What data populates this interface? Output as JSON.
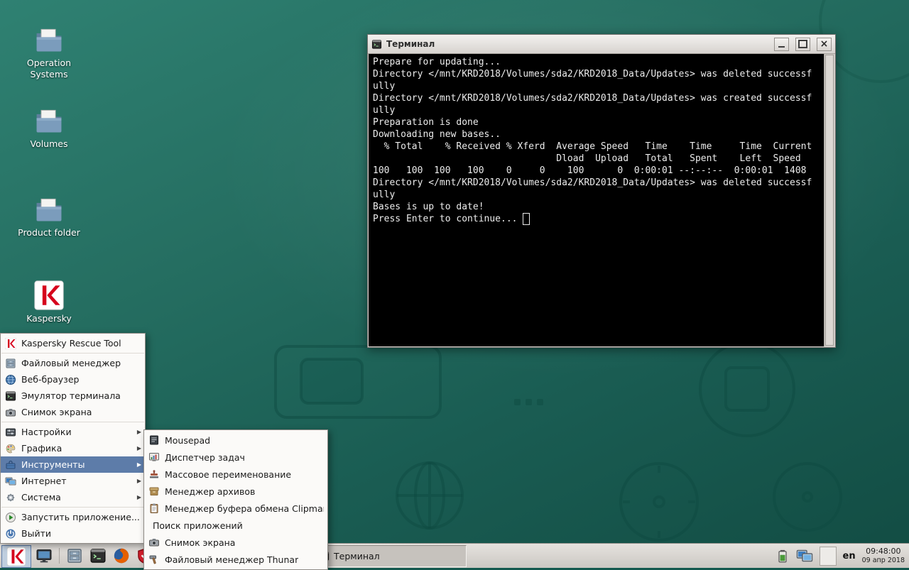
{
  "colors": {
    "desktop_teal": "#1f6a5e",
    "menu_highlight_blue": "#5d7ca9",
    "kaspersky_red": "#d6001c",
    "terminal_background": "#000000",
    "terminal_text": "#ffffff",
    "taskbar_gray": "#d5d1cc"
  },
  "desktop": {
    "icons": [
      {
        "label": "Operation Systems",
        "icon": "folder-icon"
      },
      {
        "label": "Volumes",
        "icon": "folder-icon"
      },
      {
        "label": "Product folder",
        "icon": "folder-icon"
      },
      {
        "label": "Kaspersky",
        "icon": "kaspersky-logo-icon"
      }
    ]
  },
  "terminal_window": {
    "title": "Терминал",
    "lines": [
      "Prepare for updating...",
      "Directory </mnt/KRD2018/Volumes/sda2/KRD2018_Data/Updates> was deleted successf",
      "ully",
      "Directory </mnt/KRD2018/Volumes/sda2/KRD2018_Data/Updates> was created successf",
      "ully",
      "Preparation is done",
      "Downloading new bases..",
      "  % Total    % Received % Xferd  Average Speed   Time    Time     Time  Current",
      "                                 Dload  Upload   Total   Spent    Left  Speed",
      "100   100  100   100    0     0    100      0  0:00:01 --:--:--  0:00:01  1408",
      "Directory </mnt/KRD2018/Volumes/sda2/KRD2018_Data/Updates> was deleted successf",
      "ully",
      "Bases is up to date!",
      "Press Enter to continue... "
    ]
  },
  "menu": {
    "items": [
      {
        "label": "Kaspersky Rescue Tool",
        "icon": "kaspersky-icon",
        "has_submenu": false
      },
      {
        "label": "Файловый менеджер",
        "icon": "file-manager-icon",
        "has_submenu": false
      },
      {
        "label": "Веб-браузер",
        "icon": "web-browser-icon",
        "has_submenu": false
      },
      {
        "label": "Эмулятор терминала",
        "icon": "terminal-icon",
        "has_submenu": false
      },
      {
        "label": "Снимок экрана",
        "icon": "screenshot-icon",
        "has_submenu": false
      },
      {
        "label": "Настройки",
        "icon": "settings-icon",
        "has_submenu": true
      },
      {
        "label": "Графика",
        "icon": "graphics-icon",
        "has_submenu": true
      },
      {
        "label": "Инструменты",
        "icon": "tools-icon",
        "has_submenu": true,
        "selected": true
      },
      {
        "label": "Интернет",
        "icon": "internet-icon",
        "has_submenu": true
      },
      {
        "label": "Система",
        "icon": "system-icon",
        "has_submenu": true
      },
      {
        "label": "Запустить приложение...",
        "icon": "run-icon",
        "has_submenu": false
      },
      {
        "label": "Выйти",
        "icon": "logout-icon",
        "has_submenu": false
      }
    ]
  },
  "submenu": {
    "items": [
      {
        "label": "Mousepad",
        "icon": "mousepad-icon"
      },
      {
        "label": "Диспетчер задач",
        "icon": "task-manager-icon"
      },
      {
        "label": "Массовое переименование",
        "icon": "bulk-rename-icon"
      },
      {
        "label": "Менеджер архивов",
        "icon": "archive-manager-icon"
      },
      {
        "label": "Менеджер буфера обмена Clipman",
        "icon": "clipboard-icon"
      },
      {
        "label": "Поиск приложений",
        "icon": null
      },
      {
        "label": "Снимок экрана",
        "icon": "camera-icon"
      },
      {
        "label": "Файловый менеджер Thunar",
        "icon": "thunar-icon"
      }
    ]
  },
  "taskbar": {
    "window_button": {
      "label": "Терминал",
      "icon": "terminal-icon"
    },
    "launchers": [
      {
        "name": "file-manager"
      },
      {
        "name": "terminal"
      },
      {
        "name": "web-browser"
      },
      {
        "name": "kaspersky-tool"
      }
    ],
    "tray": {
      "keyboard_layout": "en",
      "time": "09:48:00",
      "date": "09 апр 2018"
    }
  }
}
